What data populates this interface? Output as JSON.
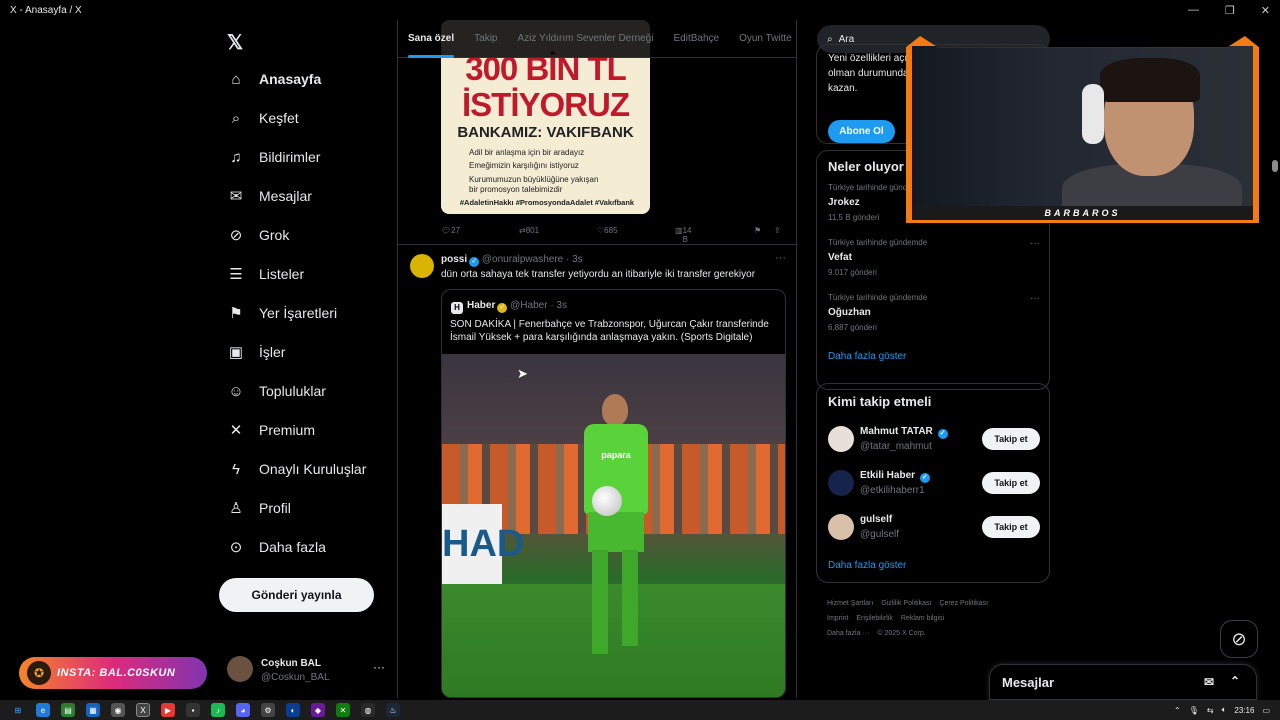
{
  "window": {
    "title": "X - Anasayfa / X"
  },
  "nav": {
    "items": [
      {
        "label": "Anasayfa",
        "icon": "home-icon"
      },
      {
        "label": "Keşfet",
        "icon": "search-icon"
      },
      {
        "label": "Bildirimler",
        "icon": "bell-icon"
      },
      {
        "label": "Mesajlar",
        "icon": "mail-icon"
      },
      {
        "label": "Grok",
        "icon": "grok-icon"
      },
      {
        "label": "Listeler",
        "icon": "list-icon"
      },
      {
        "label": "Yer İşaretleri",
        "icon": "bookmark-icon"
      },
      {
        "label": "İşler",
        "icon": "briefcase-icon"
      },
      {
        "label": "Topluluklar",
        "icon": "communities-icon"
      },
      {
        "label": "Premium",
        "icon": "x-icon"
      },
      {
        "label": "Onaylı Kuruluşlar",
        "icon": "lightning-icon"
      },
      {
        "label": "Profil",
        "icon": "person-icon"
      },
      {
        "label": "Daha fazla",
        "icon": "more-circle-icon"
      }
    ],
    "post_button": "Gönderi yayınla",
    "profile": {
      "name": "Coşkun BAL",
      "handle": "@Coskun_BAL"
    }
  },
  "overlay": {
    "insta": "INSTA: BAL.C0SKUN",
    "webcam_label": "BARBAROS"
  },
  "feed": {
    "tabs": [
      "Sana özel",
      "Takip",
      "Aziz Yıldırım Sevenler Derneği",
      "EditBahçe",
      "Oyun Twitte"
    ],
    "poster": {
      "line1": "300 BİN TL",
      "line2": "İSTİYORUZ",
      "line3": "BANKAMIZ: VAKIFBANK",
      "bullets": [
        "Adil bir anlaşma için bir aradayız",
        "Emeğimizin karşılığını istiyoruz",
        "Kurumumuzun büyüklüğüne yakışan",
        "bir promosyon talebimizdir"
      ],
      "hashtags": "#AdaletinHakkı #PromosyondaAdalet #Vakıfbank"
    },
    "tweet1_actions": {
      "replies": "27",
      "reposts": "801",
      "likes": "685",
      "views": "14 B"
    },
    "tweet2": {
      "name": "possi",
      "handle": "@onuralpwashere",
      "time": "· 3s",
      "text": "dün orta sahaya tek transfer yetiyordu an itibariyle iki transfer gerekiyor",
      "quote": {
        "name": "Haber",
        "handle": "@Haber",
        "time": "· 3s",
        "text": "SON DAKİKA | Fenerbahçe ve Trabzonspor, Uğurcan Çakır transferinde İsmail Yüksek + para karşılığında anlaşmaya yakın. (Sports Digitale)",
        "jersey_text": "papara",
        "board_text": "HAD"
      }
    }
  },
  "right": {
    "search_placeholder": "Ara",
    "premium_text": "Yeni özellikleri açı olman durumunda kazan.",
    "subscribe_button": "Abone Ol",
    "trends_title": "Neler oluyor",
    "trends": [
      {
        "context": "Türkiye tarihinde gündemde",
        "name": "Jrokez",
        "count": "11,5 B gönderi"
      },
      {
        "context": "Türkiye tarihinde gündemde",
        "name": "Vefat",
        "count": "9.017 gönderi"
      },
      {
        "context": "Türkiye tarihinde gündemde",
        "name": "Oğuzhan",
        "count": "6.887 gönderi"
      }
    ],
    "show_more": "Daha fazla göster",
    "follow_title": "Kimi takip etmeli",
    "who": [
      {
        "name": "Mahmut TATAR",
        "handle": "@tatar_mahmut",
        "button": "Takip et"
      },
      {
        "name": "Etkili Haber",
        "handle": "@etkilihaberr1",
        "button": "Takip et"
      },
      {
        "name": "gulself",
        "handle": "@gulself",
        "button": "Takip et"
      }
    ],
    "footer": [
      "Hizmet Şartları",
      "Gizlilik Politikası",
      "Çerez Politikası",
      "Imprint",
      "Erişilebilirlik",
      "Reklam bilgisi",
      "Daha fazla ···",
      "© 2025 X Corp."
    ]
  },
  "messages": {
    "label": "Mesajlar"
  },
  "taskbar": {
    "time": "23:16"
  }
}
